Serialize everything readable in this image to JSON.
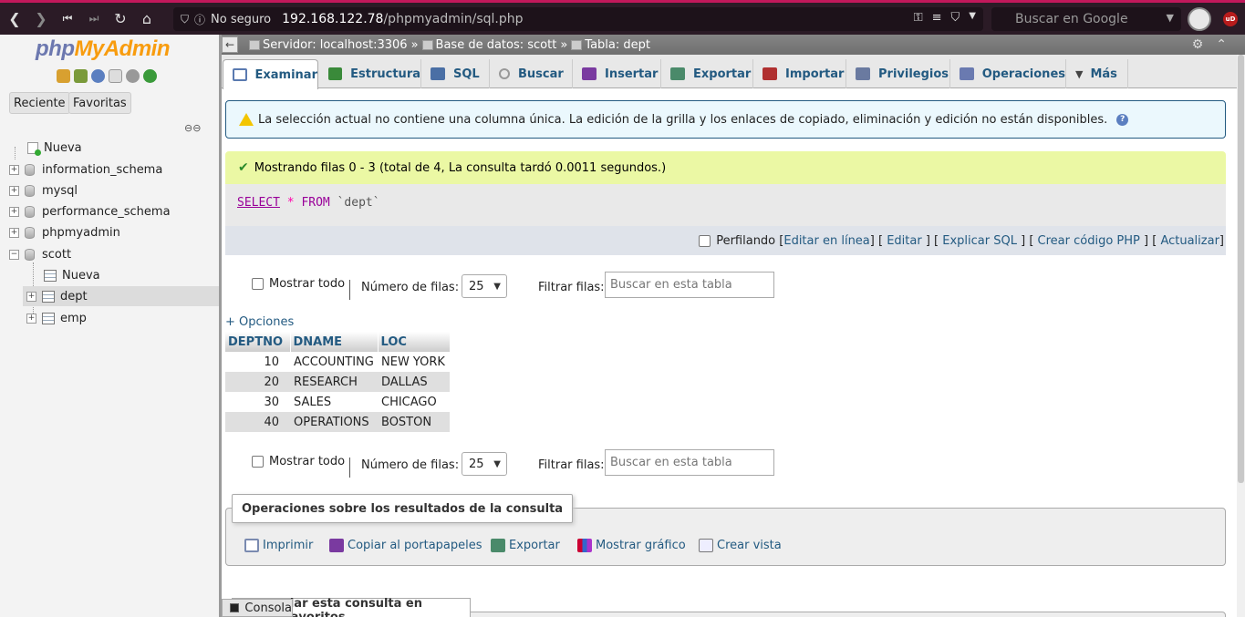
{
  "browser": {
    "insecure_label": "No seguro",
    "url_host": "192.168.122.78",
    "url_path": "/phpmyadmin/sql.php",
    "search_placeholder": "Buscar en Google",
    "ublock_label": "uD"
  },
  "sidebar": {
    "logo_php": "php",
    "logo_ma": "MyAdmin",
    "recent_label": "Reciente",
    "favorites_label": "Favoritas",
    "tree": [
      {
        "label": "Nueva"
      },
      {
        "label": "information_schema"
      },
      {
        "label": "mysql"
      },
      {
        "label": "performance_schema"
      },
      {
        "label": "phpmyadmin"
      },
      {
        "label": "scott"
      },
      {
        "label": "Nueva"
      },
      {
        "label": "dept"
      },
      {
        "label": "emp"
      }
    ]
  },
  "breadcrumb": {
    "server": "Servidor: localhost:3306",
    "database": "Base de datos: scott",
    "table": "Tabla: dept",
    "sep": "»"
  },
  "tabs": [
    {
      "label": "Examinar",
      "color": "#5a7ab0"
    },
    {
      "label": "Estructura",
      "color": "#3a8a3a"
    },
    {
      "label": "SQL",
      "color": "#4a6fa5"
    },
    {
      "label": "Buscar",
      "color": "#999999"
    },
    {
      "label": "Insertar",
      "color": "#7a3aa0"
    },
    {
      "label": "Exportar",
      "color": "#4a8a6a"
    },
    {
      "label": "Importar",
      "color": "#b03030"
    },
    {
      "label": "Privilegios",
      "color": "#6a7aa0"
    },
    {
      "label": "Operaciones",
      "color": "#6a7ab0"
    },
    {
      "label": "Más",
      "color": "#444444"
    }
  ],
  "notice": {
    "text": "La selección actual no contiene una columna única. La edición de la grilla y los enlaces de copiado, eliminación y edición no están disponibles."
  },
  "success": {
    "text": "Mostrando filas 0 - 3 (total de 4, La consulta tardó 0.0011 segundos.)"
  },
  "sql": {
    "select": "SELECT",
    "star": "*",
    "from": "FROM",
    "table": "`dept`"
  },
  "sql_tools": {
    "profiling": "Perfilando",
    "bracket_open": "[",
    "bracket_mid": "] [",
    "bracket_close": "]",
    "edit_inline": "Editar en línea",
    "edit": "Editar",
    "explain": "Explicar SQL",
    "php_code": "Crear código PHP",
    "refresh": "Actualizar"
  },
  "navigation": {
    "show_all": "Mostrar todo",
    "rows_label": "Número de filas:",
    "rows_value": "25",
    "filter_label": "Filtrar filas:",
    "filter_placeholder": "Buscar en esta tabla"
  },
  "options_link": "+ Opciones",
  "table": {
    "columns": [
      "DEPTNO",
      "DNAME",
      "LOC"
    ],
    "rows": [
      [
        "10",
        "ACCOUNTING",
        "NEW YORK"
      ],
      [
        "20",
        "RESEARCH",
        "DALLAS"
      ],
      [
        "30",
        "SALES",
        "CHICAGO"
      ],
      [
        "40",
        "OPERATIONS",
        "BOSTON"
      ]
    ]
  },
  "query_ops": {
    "legend": "Operaciones sobre los resultados de la consulta",
    "print": "Imprimir",
    "copy": "Copiar al portapapeles",
    "export": "Exportar",
    "chart": "Mostrar gráfico",
    "view": "Crear vista"
  },
  "bookmark_legend": "dar esta consulta en favoritos",
  "console_label": "Consola"
}
